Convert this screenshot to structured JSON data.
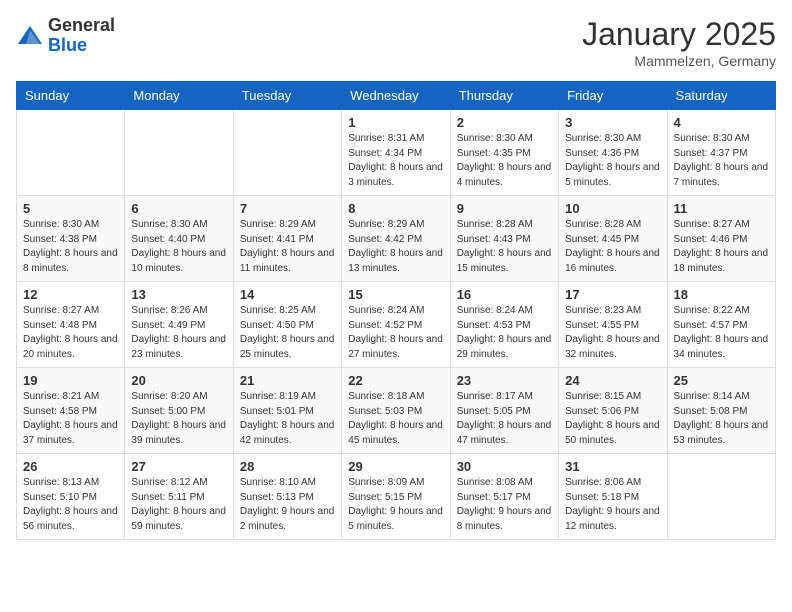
{
  "header": {
    "logo_general": "General",
    "logo_blue": "Blue",
    "month": "January 2025",
    "location": "Mammelzen, Germany"
  },
  "days_of_week": [
    "Sunday",
    "Monday",
    "Tuesday",
    "Wednesday",
    "Thursday",
    "Friday",
    "Saturday"
  ],
  "weeks": [
    [
      {
        "num": "",
        "info": ""
      },
      {
        "num": "",
        "info": ""
      },
      {
        "num": "",
        "info": ""
      },
      {
        "num": "1",
        "info": "Sunrise: 8:31 AM\nSunset: 4:34 PM\nDaylight: 8 hours\nand 3 minutes."
      },
      {
        "num": "2",
        "info": "Sunrise: 8:30 AM\nSunset: 4:35 PM\nDaylight: 8 hours\nand 4 minutes."
      },
      {
        "num": "3",
        "info": "Sunrise: 8:30 AM\nSunset: 4:36 PM\nDaylight: 8 hours\nand 5 minutes."
      },
      {
        "num": "4",
        "info": "Sunrise: 8:30 AM\nSunset: 4:37 PM\nDaylight: 8 hours\nand 7 minutes."
      }
    ],
    [
      {
        "num": "5",
        "info": "Sunrise: 8:30 AM\nSunset: 4:38 PM\nDaylight: 8 hours\nand 8 minutes."
      },
      {
        "num": "6",
        "info": "Sunrise: 8:30 AM\nSunset: 4:40 PM\nDaylight: 8 hours\nand 10 minutes."
      },
      {
        "num": "7",
        "info": "Sunrise: 8:29 AM\nSunset: 4:41 PM\nDaylight: 8 hours\nand 11 minutes."
      },
      {
        "num": "8",
        "info": "Sunrise: 8:29 AM\nSunset: 4:42 PM\nDaylight: 8 hours\nand 13 minutes."
      },
      {
        "num": "9",
        "info": "Sunrise: 8:28 AM\nSunset: 4:43 PM\nDaylight: 8 hours\nand 15 minutes."
      },
      {
        "num": "10",
        "info": "Sunrise: 8:28 AM\nSunset: 4:45 PM\nDaylight: 8 hours\nand 16 minutes."
      },
      {
        "num": "11",
        "info": "Sunrise: 8:27 AM\nSunset: 4:46 PM\nDaylight: 8 hours\nand 18 minutes."
      }
    ],
    [
      {
        "num": "12",
        "info": "Sunrise: 8:27 AM\nSunset: 4:48 PM\nDaylight: 8 hours\nand 20 minutes."
      },
      {
        "num": "13",
        "info": "Sunrise: 8:26 AM\nSunset: 4:49 PM\nDaylight: 8 hours\nand 23 minutes."
      },
      {
        "num": "14",
        "info": "Sunrise: 8:25 AM\nSunset: 4:50 PM\nDaylight: 8 hours\nand 25 minutes."
      },
      {
        "num": "15",
        "info": "Sunrise: 8:24 AM\nSunset: 4:52 PM\nDaylight: 8 hours\nand 27 minutes."
      },
      {
        "num": "16",
        "info": "Sunrise: 8:24 AM\nSunset: 4:53 PM\nDaylight: 8 hours\nand 29 minutes."
      },
      {
        "num": "17",
        "info": "Sunrise: 8:23 AM\nSunset: 4:55 PM\nDaylight: 8 hours\nand 32 minutes."
      },
      {
        "num": "18",
        "info": "Sunrise: 8:22 AM\nSunset: 4:57 PM\nDaylight: 8 hours\nand 34 minutes."
      }
    ],
    [
      {
        "num": "19",
        "info": "Sunrise: 8:21 AM\nSunset: 4:58 PM\nDaylight: 8 hours\nand 37 minutes."
      },
      {
        "num": "20",
        "info": "Sunrise: 8:20 AM\nSunset: 5:00 PM\nDaylight: 8 hours\nand 39 minutes."
      },
      {
        "num": "21",
        "info": "Sunrise: 8:19 AM\nSunset: 5:01 PM\nDaylight: 8 hours\nand 42 minutes."
      },
      {
        "num": "22",
        "info": "Sunrise: 8:18 AM\nSunset: 5:03 PM\nDaylight: 8 hours\nand 45 minutes."
      },
      {
        "num": "23",
        "info": "Sunrise: 8:17 AM\nSunset: 5:05 PM\nDaylight: 8 hours\nand 47 minutes."
      },
      {
        "num": "24",
        "info": "Sunrise: 8:15 AM\nSunset: 5:06 PM\nDaylight: 8 hours\nand 50 minutes."
      },
      {
        "num": "25",
        "info": "Sunrise: 8:14 AM\nSunset: 5:08 PM\nDaylight: 8 hours\nand 53 minutes."
      }
    ],
    [
      {
        "num": "26",
        "info": "Sunrise: 8:13 AM\nSunset: 5:10 PM\nDaylight: 8 hours\nand 56 minutes."
      },
      {
        "num": "27",
        "info": "Sunrise: 8:12 AM\nSunset: 5:11 PM\nDaylight: 8 hours\nand 59 minutes."
      },
      {
        "num": "28",
        "info": "Sunrise: 8:10 AM\nSunset: 5:13 PM\nDaylight: 9 hours\nand 2 minutes."
      },
      {
        "num": "29",
        "info": "Sunrise: 8:09 AM\nSunset: 5:15 PM\nDaylight: 9 hours\nand 5 minutes."
      },
      {
        "num": "30",
        "info": "Sunrise: 8:08 AM\nSunset: 5:17 PM\nDaylight: 9 hours\nand 8 minutes."
      },
      {
        "num": "31",
        "info": "Sunrise: 8:06 AM\nSunset: 5:18 PM\nDaylight: 9 hours\nand 12 minutes."
      },
      {
        "num": "",
        "info": ""
      }
    ]
  ]
}
